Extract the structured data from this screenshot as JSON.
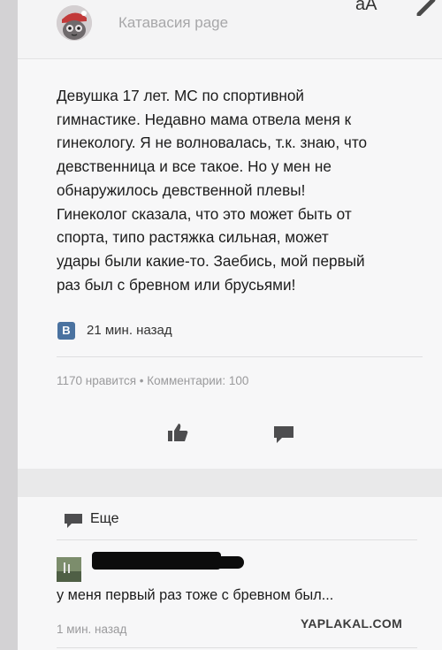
{
  "header": {
    "page_name": "Катавасия page",
    "font_toggle": "аА",
    "avatar_icon": "cat-avatar-icon",
    "edit_icon": "pencil-icon"
  },
  "post": {
    "lines": [
      "Девушка 17 лет. МС по спортивной",
      "гимнастике. Недавно мама отвела меня к",
      "гинекологу. Я не волновалась, т.к. знаю, что",
      "девственница и все такое. Но у мен не",
      "обнаружилось девственной плевы!",
      "Гинеколог сказала, что это может быть от",
      "спорта, типо растяжка сильная, может",
      "удары были какие-то. Заебись, мой первый",
      "раз был с бревном или брусьями!"
    ],
    "source_badge": "В",
    "time_ago": "21 мин. назад",
    "stats": "1170 нравится • Комментарии: 100",
    "like_icon": "thumbs-up-icon",
    "comment_icon": "speech-bubble-icon"
  },
  "comments": {
    "more_label": "Еще",
    "more_icon": "speech-bubble-icon",
    "comment_text": "у меня первый раз тоже с бревном был...",
    "comment_time": "1 мин. назад"
  },
  "watermark": "YAPLAKAL.COM",
  "colors": {
    "vk_blue": "#4a72a0",
    "background": "#e9e9ea",
    "card": "#f7f7f8",
    "muted_text": "#9a9a9c"
  }
}
